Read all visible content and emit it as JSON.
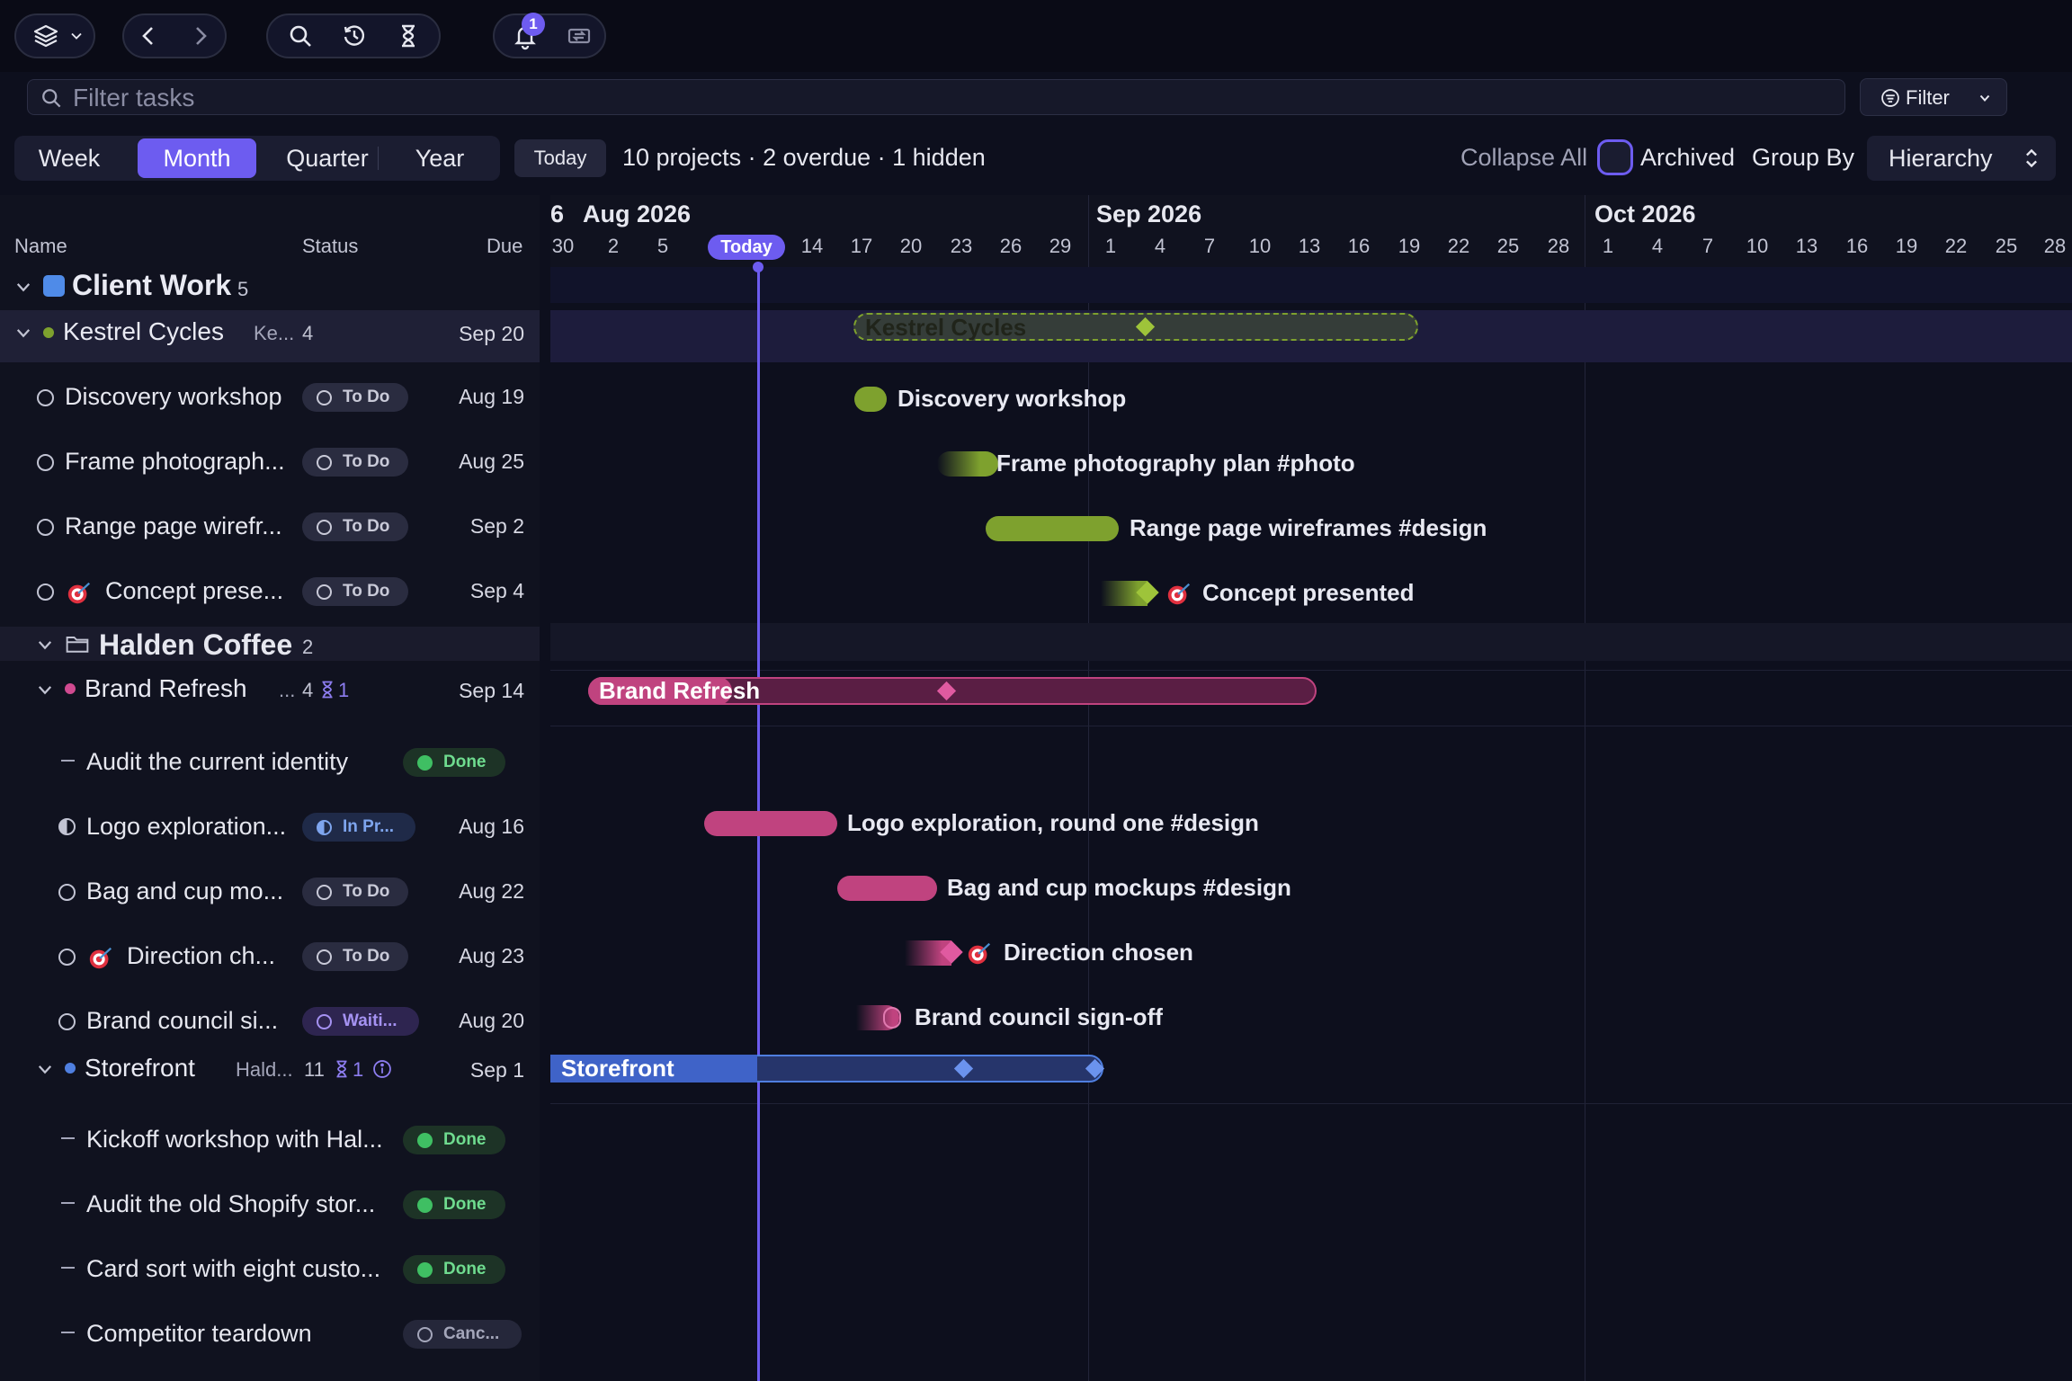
{
  "toolbar": {
    "icons": [
      "layers-icon",
      "chevron-down-icon",
      "back-icon",
      "forward-icon",
      "search-icon",
      "history-icon",
      "hourglass-icon",
      "bell-icon",
      "sync-icon"
    ],
    "notification_count": "1"
  },
  "filter_bar": {
    "placeholder": "Filter tasks",
    "filter_label": "Filter"
  },
  "view_modes": {
    "week": "Week",
    "month": "Month",
    "quarter": "Quarter",
    "year": "Year",
    "active": "Month"
  },
  "today_button": "Today",
  "summary": "10 projects · 2 overdue · 1 hidden",
  "controls": {
    "collapse_all": "Collapse All",
    "archived": "Archived",
    "group_by": "Group By",
    "group_by_value": "Hierarchy"
  },
  "columns": {
    "name": "Name",
    "status": "Status",
    "due": "Due"
  },
  "timeline": {
    "months": [
      "Aug 2026",
      "Sep 2026",
      "Oct 2026"
    ],
    "partial_month": "6",
    "today_label": "Today",
    "days": [
      "30",
      "2",
      "5",
      "8",
      "14",
      "17",
      "20",
      "23",
      "26",
      "29",
      "1",
      "4",
      "7",
      "10",
      "13",
      "16",
      "19",
      "22",
      "25",
      "28",
      "1",
      "4",
      "7",
      "10",
      "13",
      "16",
      "19",
      "22",
      "25",
      "28"
    ]
  },
  "colors": {
    "accent": "#6d5cf0",
    "green": "#7ea12e",
    "pink": "#c0437f",
    "blue": "#3f63c8",
    "done": "#3fbf63"
  },
  "tree": {
    "group": {
      "name": "Client Work",
      "count": "5"
    },
    "kestrel": {
      "name": "Kestrel Cycles",
      "owner": "Ke...",
      "count": "4",
      "due": "Sep 20",
      "tasks": [
        {
          "name": "Discovery workshop",
          "status": "To Do",
          "due": "Aug 19",
          "bar_label": "Discovery workshop"
        },
        {
          "name": "Frame photograph...",
          "status": "To Do",
          "due": "Aug 25",
          "bar_label": "Frame photography plan #photo"
        },
        {
          "name": "Range page wirefr...",
          "status": "To Do",
          "due": "Sep 2",
          "bar_label": "Range page wireframes #design"
        },
        {
          "name": "Concept prese...",
          "status": "To Do",
          "due": "Sep 4",
          "bar_label": "Concept presented"
        }
      ]
    },
    "halden": {
      "name": "Halden Coffee",
      "count": "2",
      "brand": {
        "name": "Brand Refresh",
        "owner": "...",
        "count": "4",
        "waiting": "1",
        "due": "Sep 14",
        "tasks": [
          {
            "name": "Audit the current identity",
            "status": "Done",
            "due": ""
          },
          {
            "name": "Logo exploration...",
            "status": "In Pr...",
            "due": "Aug 16",
            "bar_label": "Logo exploration, round one #design"
          },
          {
            "name": "Bag and cup mo...",
            "status": "To Do",
            "due": "Aug 22",
            "bar_label": "Bag and cup mockups #design"
          },
          {
            "name": "Direction ch...",
            "status": "To Do",
            "due": "Aug 23",
            "bar_label": "Direction chosen"
          },
          {
            "name": "Brand council si...",
            "status": "Waiti...",
            "due": "Aug 20",
            "bar_label": "Brand council sign-off"
          }
        ]
      },
      "storefront": {
        "name": "Storefront",
        "owner": "Hald...",
        "count": "11",
        "waiting": "1",
        "due": "Sep 1",
        "tasks": [
          {
            "name": "Kickoff workshop with Hal...",
            "status": "Done"
          },
          {
            "name": "Audit the old Shopify stor...",
            "status": "Done"
          },
          {
            "name": "Card sort with eight custo...",
            "status": "Done"
          },
          {
            "name": "Competitor teardown",
            "status": "Canc..."
          }
        ]
      }
    }
  }
}
